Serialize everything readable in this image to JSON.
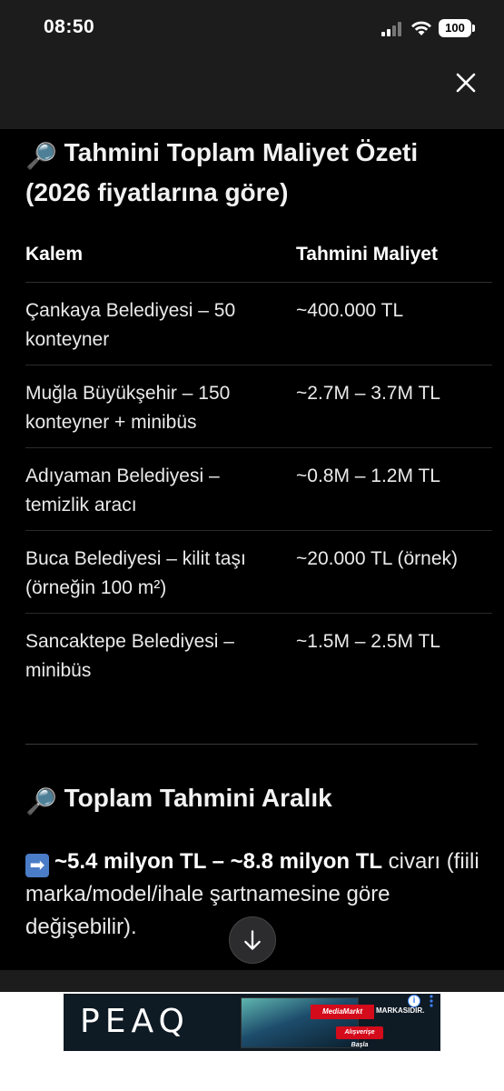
{
  "status_bar": {
    "time": "08:50",
    "battery": "100"
  },
  "section1": {
    "emoji": "🔎",
    "title": "Tahmini Toplam Maliyet Özeti (2026 fiyatlarına göre)"
  },
  "table": {
    "headers": [
      "Kalem",
      "Tahmini Maliyet"
    ],
    "rows": [
      {
        "item": "Çankaya Belediyesi – 50 konteyner",
        "cost": "~400.000 TL"
      },
      {
        "item": "Muğla Büyükşehir – 150 konteyner + minibüs",
        "cost": "~2.7M – 3.7M TL"
      },
      {
        "item": "Adıyaman Belediyesi – temizlik aracı",
        "cost": "~0.8M – 1.2M TL"
      },
      {
        "item": "Buca Belediyesi – kilit taşı (örneğin 100 m²)",
        "cost": "~20.000 TL (örnek)"
      },
      {
        "item": "Sancaktepe Belediyesi – minibüs",
        "cost": "~1.5M – 2.5M TL"
      }
    ]
  },
  "section2": {
    "emoji": "🔎",
    "title": "Toplam Tahmini Aralık"
  },
  "summary": {
    "arrow": "➡",
    "bold": "~5.4 milyon TL – ~8.8 milyon TL",
    "rest": " civarı (fiili marka/model/ihale şartnamesine göre değişebilir)."
  },
  "ad": {
    "logo": "PEAQ",
    "brand": "MediaMarkt",
    "brand_tag": "MARKASIDIR.",
    "cta": "Alışverişe Başla",
    "info": "i"
  },
  "colors": {
    "background": "#000000",
    "bars": "#1c1c1c",
    "text": "#ffffff",
    "accent_blue": "#4a7cc7"
  }
}
